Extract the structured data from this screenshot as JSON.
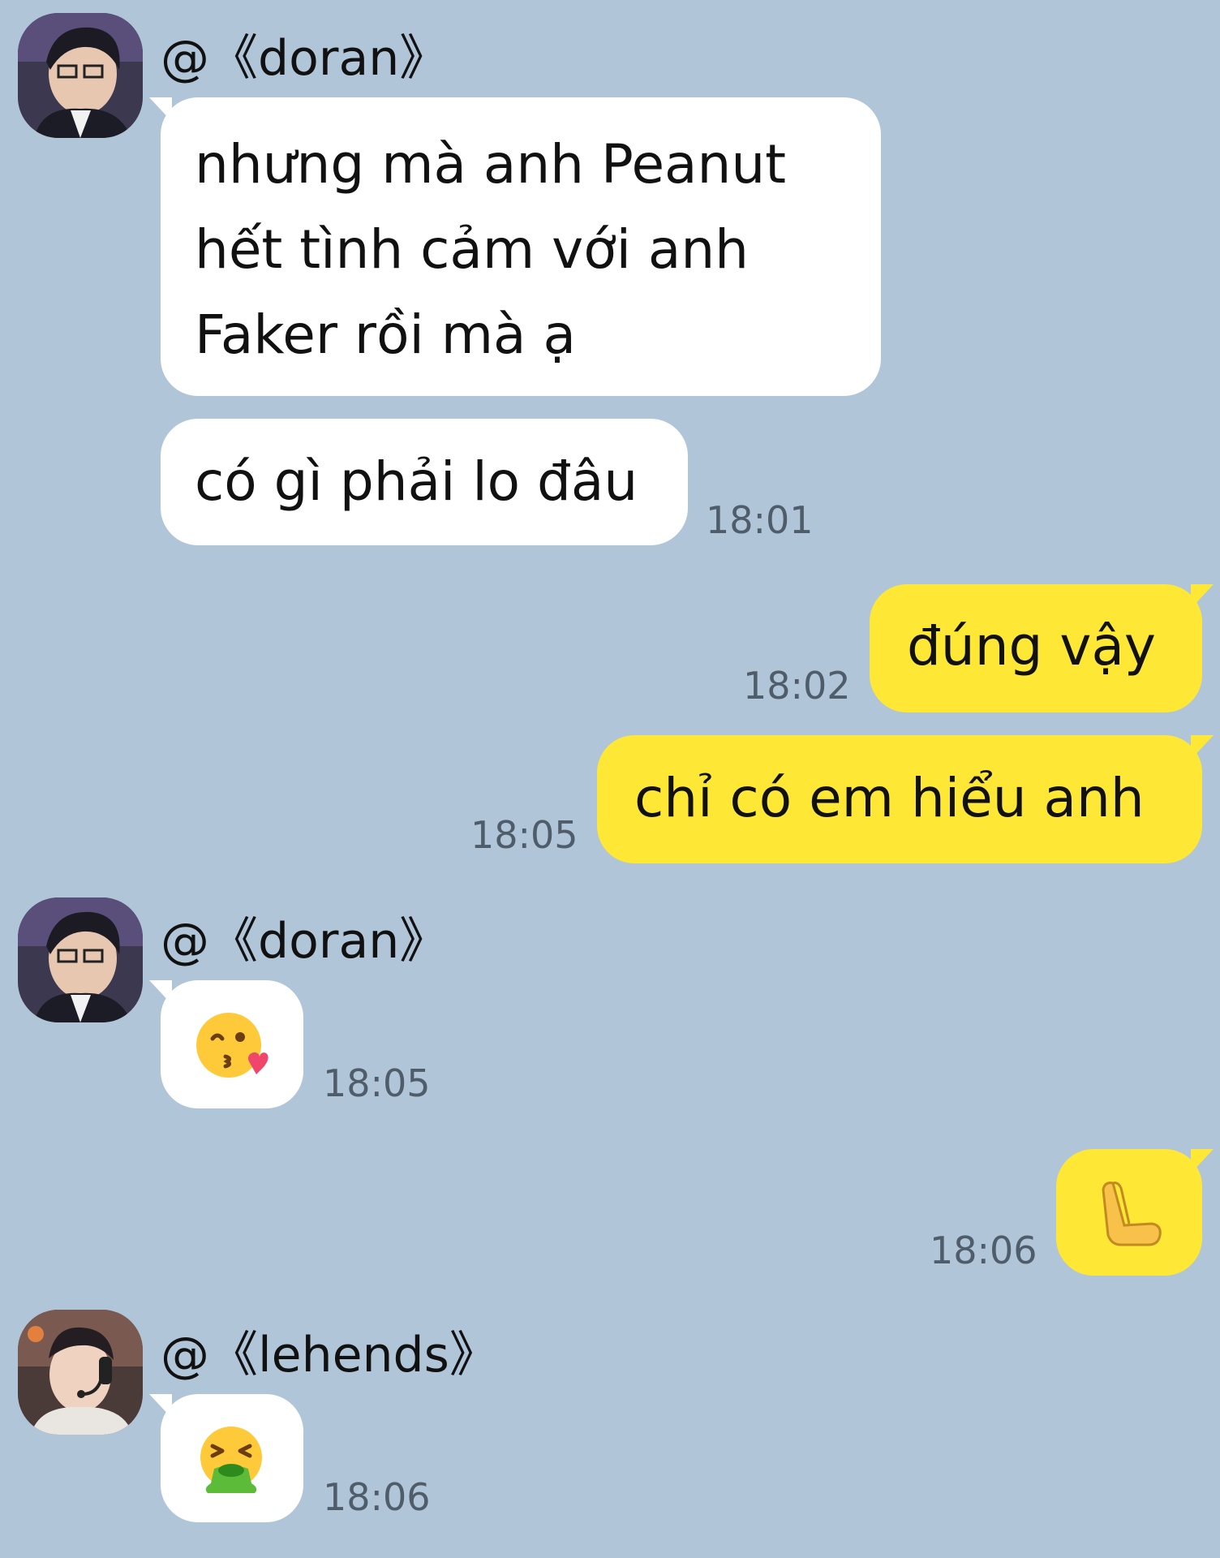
{
  "messages": [
    {
      "sender": "@《doran》",
      "lines": [
        "nhưng mà anh Peanut\nhết tình cảm với anh\nFaker rồi mà ạ"
      ]
    },
    {
      "text": "có gì phải lo đâu",
      "time": "18:01"
    },
    {
      "text": "đúng vậy",
      "time": "18:02"
    },
    {
      "text": "chỉ có em hiểu anh",
      "time": "18:05"
    },
    {
      "sender": "@《doran》",
      "emoji": "kissing-face-with-heart-icon",
      "time": "18:05"
    },
    {
      "emoji": "hand-gesture-icon",
      "time": "18:06"
    },
    {
      "sender": "@《lehends》",
      "emoji": "vomiting-face-icon",
      "time": "18:06"
    }
  ],
  "colors": {
    "background": "#b1c5d9",
    "incoming_bubble": "#ffffff",
    "outgoing_bubble": "#fee835",
    "time_text": "#4f5d6b"
  }
}
